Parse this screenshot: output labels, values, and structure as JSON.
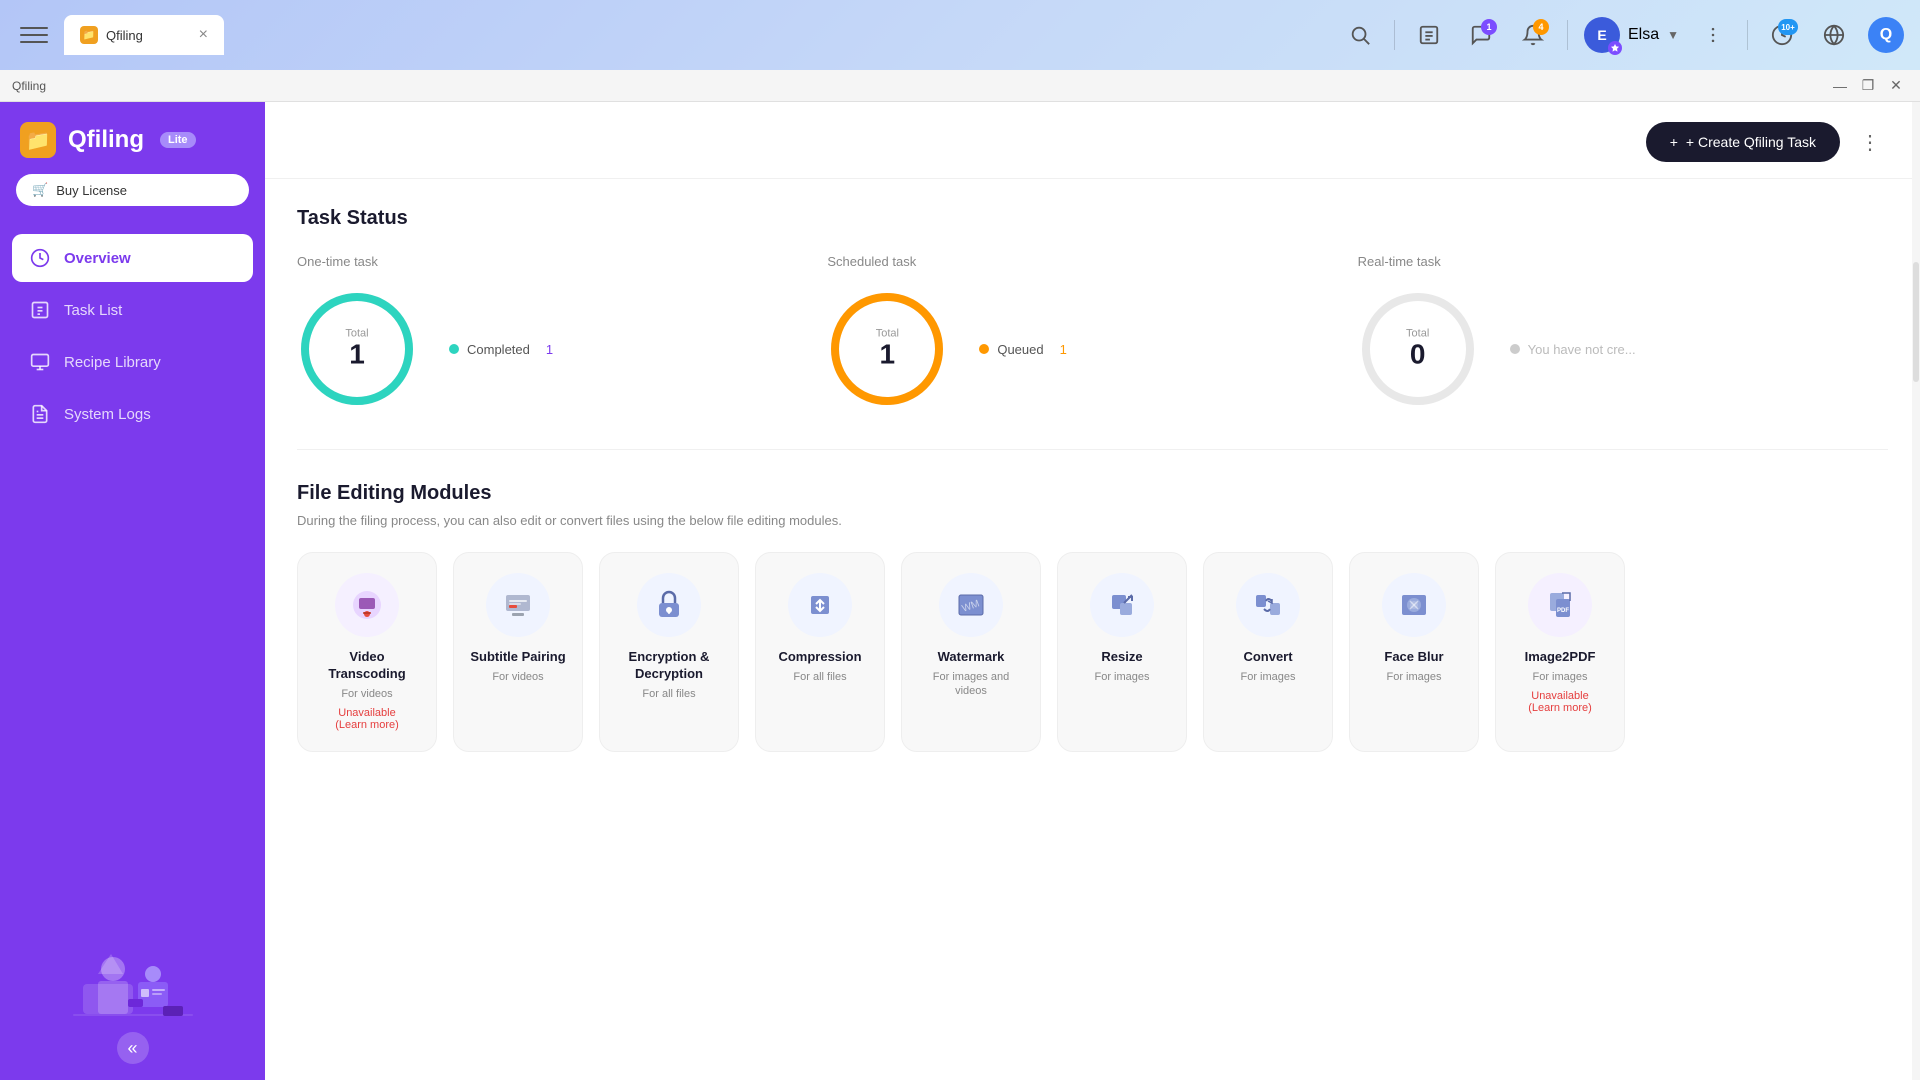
{
  "browser": {
    "tab_label": "Qfiling",
    "tab_close": "×",
    "title_bar_text": "Qfiling",
    "window_minimize": "—",
    "window_maximize": "❐",
    "window_close": "✕",
    "badge_messages": "1",
    "badge_notifications": "4",
    "badge_online": "10+",
    "user_name": "Elsa",
    "search_icon": "🔍",
    "hamburger_icon": "☰"
  },
  "sidebar": {
    "app_title": "Qfiling",
    "lite_badge": "Lite",
    "buy_license_label": "Buy License",
    "nav_items": [
      {
        "id": "overview",
        "label": "Overview",
        "active": true
      },
      {
        "id": "task-list",
        "label": "Task List",
        "active": false
      },
      {
        "id": "recipe-library",
        "label": "Recipe Library",
        "active": false
      },
      {
        "id": "system-logs",
        "label": "System Logs",
        "active": false
      }
    ],
    "collapse_icon": "«"
  },
  "header": {
    "create_task_label": "+ Create Qfiling Task",
    "more_icon": "⋮"
  },
  "task_status": {
    "section_title": "Task Status",
    "columns": [
      {
        "id": "one-time",
        "title": "One-time task",
        "total_label": "Total",
        "total": "1",
        "stats": [
          {
            "label": "Completed",
            "value": "1",
            "color": "#2dd4bf"
          }
        ],
        "donut_color": "green",
        "donut_pct": 100
      },
      {
        "id": "scheduled",
        "title": "Scheduled task",
        "total_label": "Total",
        "total": "1",
        "stats": [
          {
            "label": "Queued",
            "value": "1",
            "color": "#ff9800"
          }
        ],
        "donut_color": "orange",
        "donut_pct": 100
      },
      {
        "id": "realtime",
        "title": "Real-time task",
        "total_label": "Total",
        "total": "0",
        "stats": [
          {
            "label": "You have not cre...",
            "value": "",
            "color": "#ccc"
          }
        ],
        "donut_color": "gray",
        "donut_pct": 0
      }
    ]
  },
  "modules": {
    "title": "File Editing Modules",
    "subtitle": "During the filing process, you can also edit or convert files using the below file editing modules.",
    "items": [
      {
        "id": "video-transcoding",
        "name": "Video Transcoding",
        "desc": "For videos",
        "icon": "🎬",
        "unavailable": true,
        "unavailable_text": "Unavailable",
        "learn_more": "(Learn more)"
      },
      {
        "id": "subtitle-pairing",
        "name": "Subtitle Pairing",
        "desc": "For videos",
        "icon": "📄",
        "unavailable": false
      },
      {
        "id": "encryption-decryption",
        "name": "Encryption & Decryption",
        "desc": "For all files",
        "icon": "🔒",
        "unavailable": false
      },
      {
        "id": "compression",
        "name": "Compression",
        "desc": "For all files",
        "icon": "🗜",
        "unavailable": false
      },
      {
        "id": "watermark",
        "name": "Watermark",
        "desc": "For images and videos",
        "icon": "🖼",
        "unavailable": false
      },
      {
        "id": "resize",
        "name": "Resize",
        "desc": "For images",
        "icon": "↔",
        "unavailable": false
      },
      {
        "id": "convert",
        "name": "Convert",
        "desc": "For images",
        "icon": "🔄",
        "unavailable": false
      },
      {
        "id": "face-blur",
        "name": "Face Blur",
        "desc": "For images",
        "icon": "👤",
        "unavailable": false
      },
      {
        "id": "image2pdf",
        "name": "Image2PDF",
        "desc": "For images",
        "icon": "📑",
        "unavailable": true,
        "unavailable_text": "Unavailable",
        "learn_more": "(Learn more)"
      }
    ]
  }
}
